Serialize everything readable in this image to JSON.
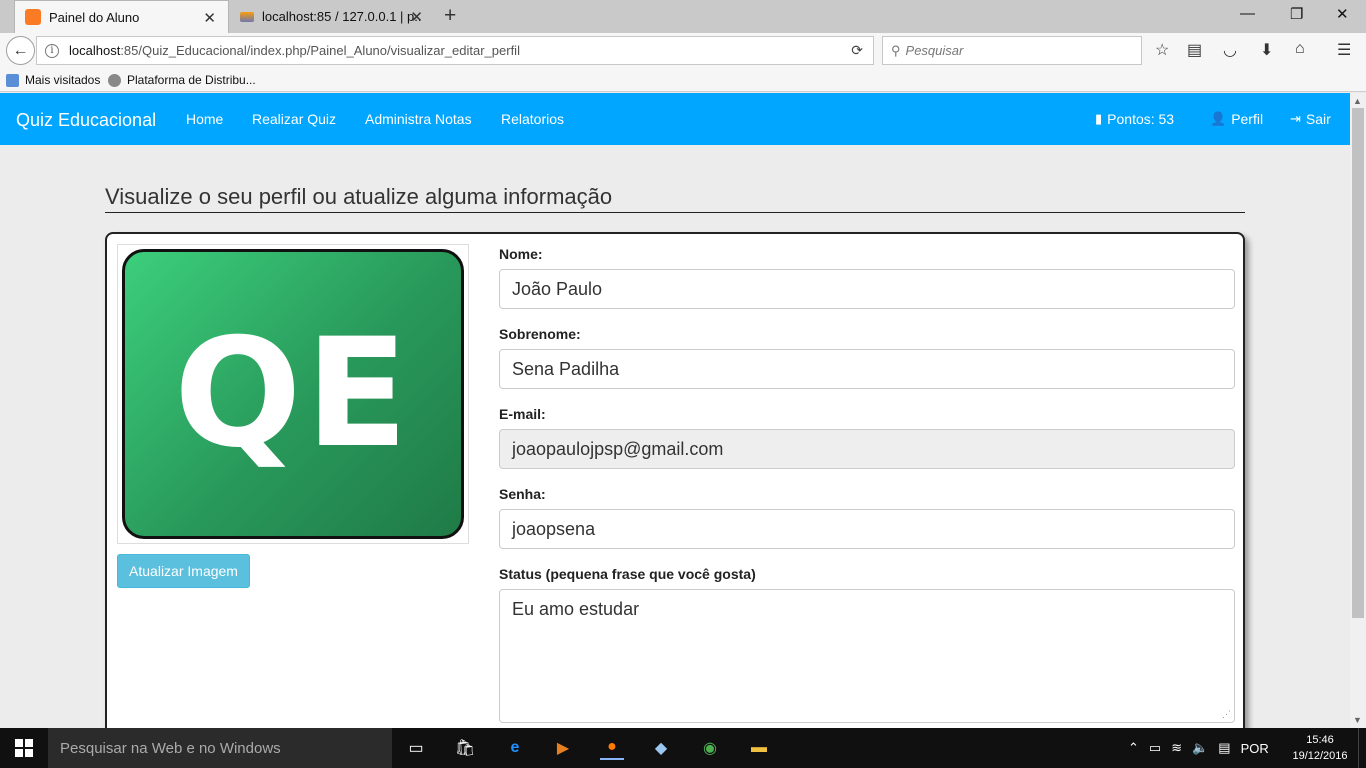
{
  "browser": {
    "tabs": [
      {
        "label": "Painel do Aluno",
        "icon": "xampp-icon",
        "active": true
      },
      {
        "label": "localhost:85 / 127.0.0.1 | p...",
        "icon": "phpmyadmin-icon",
        "active": false
      }
    ],
    "url_host": "localhost",
    "url_rest": ":85/Quiz_Educacional/index.php/Painel_Aluno/visualizar_editar_perfil",
    "search_placeholder": "Pesquisar",
    "bookmarks": [
      "Mais visitados",
      "Plataforma de Distribu..."
    ]
  },
  "app": {
    "brand": "Quiz Educacional",
    "nav": [
      "Home",
      "Realizar Quiz",
      "Administra Notas",
      "Relatorios"
    ],
    "points_label": "Pontos: 53",
    "profile_label": "Perfil",
    "logout_label": "Sair",
    "accent_color": "#00a6ff"
  },
  "page": {
    "title": "Visualize o seu perfil ou atualize alguma informação",
    "logo_text": "QE",
    "update_image_button": "Atualizar Imagem",
    "fields": {
      "nome_label": "Nome:",
      "nome_value": "João Paulo",
      "sobrenome_label": "Sobrenome:",
      "sobrenome_value": "Sena Padilha",
      "email_label": "E-mail:",
      "email_value": "joaopaulojpsp@gmail.com",
      "senha_label": "Senha:",
      "senha_value": "joaopsena",
      "status_label": "Status (pequena frase que você gosta)",
      "status_value": "Eu amo estudar"
    }
  },
  "taskbar": {
    "search_placeholder": "Pesquisar na Web e no Windows",
    "language": "POR",
    "time": "15:46",
    "date": "19/12/2016"
  }
}
